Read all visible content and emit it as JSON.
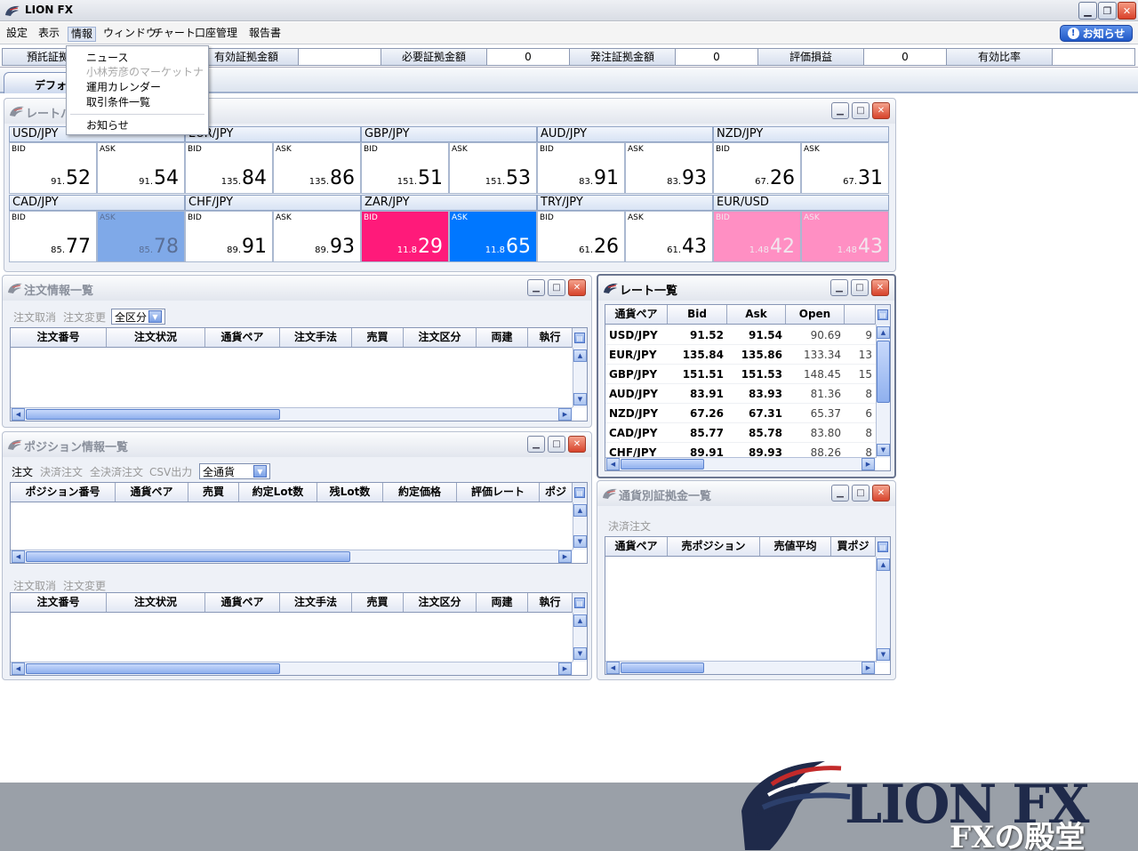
{
  "app": {
    "title": "LION FX"
  },
  "menu": [
    "設定",
    "表示",
    "情報",
    "ウィンドウ",
    "チャート",
    "口座管理",
    "報告書"
  ],
  "notice_button": "お知らせ",
  "dropdown_menu": [
    {
      "label": "ニュース",
      "disabled": false
    },
    {
      "label": "小林芳彦のマーケットナビ",
      "disabled": true
    },
    {
      "label": "運用カレンダー",
      "disabled": false
    },
    {
      "label": "取引条件一覧",
      "disabled": false
    },
    {
      "label": "お知らせ",
      "disabled": false
    }
  ],
  "status": {
    "deposit_label": "預託証拠金",
    "effective_label": "有効証拠金額",
    "effective_value": "",
    "required_label": "必要証拠金額",
    "required_value": "0",
    "order_label": "発注証拠金額",
    "order_value": "0",
    "pl_label": "評価損益",
    "pl_value": "0",
    "ratio_label": "有効比率",
    "ratio_value": ""
  },
  "tab": {
    "label": "デフォルト"
  },
  "rate_panel": {
    "title": "レートパネル",
    "bid_label": "BID",
    "ask_label": "ASK",
    "pairs": [
      {
        "name": "USD/JPY",
        "bid_s": "91.",
        "bid_b": "52",
        "ask_s": "91.",
        "ask_b": "54",
        "bid_style": "",
        "ask_style": ""
      },
      {
        "name": "EUR/JPY",
        "bid_s": "135.",
        "bid_b": "84",
        "ask_s": "135.",
        "ask_b": "86",
        "bid_style": "",
        "ask_style": ""
      },
      {
        "name": "GBP/JPY",
        "bid_s": "151.",
        "bid_b": "51",
        "ask_s": "151.",
        "ask_b": "53",
        "bid_style": "",
        "ask_style": ""
      },
      {
        "name": "AUD/JPY",
        "bid_s": "83.",
        "bid_b": "91",
        "ask_s": "83.",
        "ask_b": "93",
        "bid_style": "",
        "ask_style": ""
      },
      {
        "name": "NZD/JPY",
        "bid_s": "67.",
        "bid_b": "26",
        "ask_s": "67.",
        "ask_b": "31",
        "bid_style": "",
        "ask_style": ""
      },
      {
        "name": "CAD/JPY",
        "bid_s": "85.",
        "bid_b": "77",
        "ask_s": "85.",
        "ask_b": "78",
        "bid_style": "",
        "ask_style": "blue"
      },
      {
        "name": "CHF/JPY",
        "bid_s": "89.",
        "bid_b": "91",
        "ask_s": "89.",
        "ask_b": "93",
        "bid_style": "",
        "ask_style": ""
      },
      {
        "name": "ZAR/JPY",
        "bid_s": "11.8",
        "bid_b": "29",
        "ask_s": "11.8",
        "ask_b": "65",
        "bid_style": "magenta",
        "ask_style": "brightblue"
      },
      {
        "name": "TRY/JPY",
        "bid_s": "61.",
        "bid_b": "26",
        "ask_s": "61.",
        "ask_b": "43",
        "bid_style": "",
        "ask_style": ""
      },
      {
        "name": "EUR/USD",
        "bid_s": "1.48",
        "bid_b": "42",
        "ask_s": "1.48",
        "ask_b": "43",
        "bid_style": "pink",
        "ask_style": "pink"
      }
    ]
  },
  "order_panel": {
    "title": "注文情報一覧",
    "tools": [
      "注文取消",
      "注文変更"
    ],
    "filter": "全区分",
    "columns": [
      "注文番号",
      "注文状況",
      "通貨ペア",
      "注文手法",
      "売買",
      "注文区分",
      "両建",
      "執行"
    ]
  },
  "position_panel": {
    "title": "ポジション情報一覧",
    "tools": [
      "注文",
      "決済注文",
      "全決済注文",
      "CSV出力"
    ],
    "filter": "全通貨",
    "columns": [
      "ポジション番号",
      "通貨ペア",
      "売買",
      "約定Lot数",
      "残Lot数",
      "約定価格",
      "評価レート",
      "ポジ"
    ],
    "tools2": [
      "注文取消",
      "注文変更"
    ],
    "columns2": [
      "注文番号",
      "注文状況",
      "通貨ペア",
      "注文手法",
      "売買",
      "注文区分",
      "両建",
      "執行"
    ]
  },
  "rate_list": {
    "title": "レート一覧",
    "columns": [
      "通貨ペア",
      "Bid",
      "Ask",
      "Open",
      ""
    ],
    "rows": [
      [
        "USD/JPY",
        "91.52",
        "91.54",
        "90.69",
        "9"
      ],
      [
        "EUR/JPY",
        "135.84",
        "135.86",
        "133.34",
        "13"
      ],
      [
        "GBP/JPY",
        "151.51",
        "151.53",
        "148.45",
        "15"
      ],
      [
        "AUD/JPY",
        "83.91",
        "83.93",
        "81.36",
        "8"
      ],
      [
        "NZD/JPY",
        "67.26",
        "67.31",
        "65.37",
        "6"
      ],
      [
        "CAD/JPY",
        "85.77",
        "85.78",
        "83.80",
        "8"
      ],
      [
        "CHF/JPY",
        "89.91",
        "89.93",
        "88.26",
        "8"
      ]
    ]
  },
  "margin_panel": {
    "title": "通貨別証拠金一覧",
    "tool": "決済注文",
    "columns": [
      "通貨ペア",
      "売ポジション",
      "売値平均",
      "買ポジ"
    ]
  },
  "logo": {
    "main": "LION FX",
    "sub": "FXの殿堂"
  }
}
